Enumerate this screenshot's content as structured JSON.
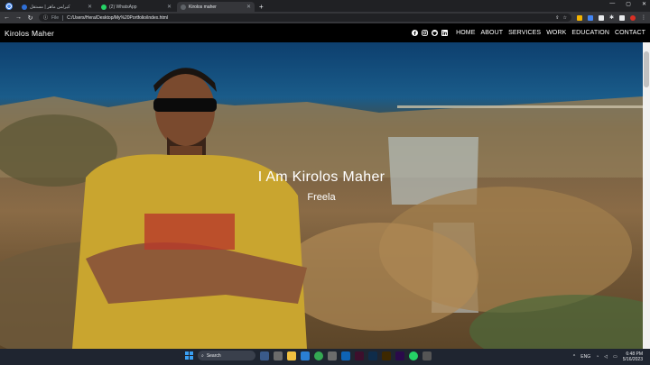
{
  "browser": {
    "tabs": [
      {
        "title": "كيرلس ماهر | مستقل",
        "favicon_color": "#2f6fd6",
        "active": false
      },
      {
        "title": "(2) WhatsApp",
        "favicon_color": "#25d366",
        "active": false
      },
      {
        "title": "Kirolos maher",
        "favicon_color": "#5f6368",
        "active": true
      }
    ],
    "new_tab": "+",
    "address": {
      "scheme_label": "File",
      "url": "C:/Users/Hera/Desktop/My%20Portfolio/index.html"
    }
  },
  "site": {
    "brand": "Kirolos Maher",
    "social_icons": [
      "facebook-icon",
      "instagram-icon",
      "github-icon",
      "linkedin-icon"
    ],
    "nav": [
      "HOME",
      "ABOUT",
      "SERVICES",
      "WORK",
      "EDUCATION",
      "CONTACT"
    ],
    "hero": {
      "title": "I Am Kirolos Maher",
      "subtitle": "Freela"
    }
  },
  "taskbar": {
    "search_placeholder": "Search",
    "language": "ENG",
    "time": "6:48 PM",
    "date": "5/16/2023"
  },
  "colors": {
    "browser_dark": "#202124",
    "header_bg": "#000000",
    "taskbar_bg": "#1f2530"
  }
}
